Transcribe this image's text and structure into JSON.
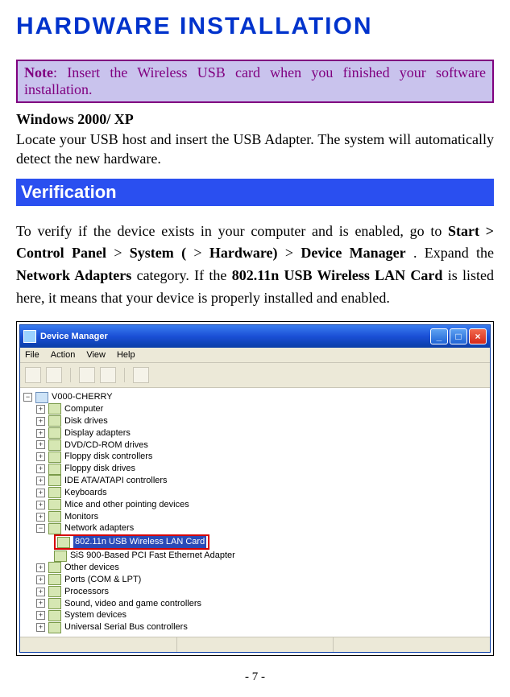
{
  "title": "HARDWARE INSTALLATION",
  "note_label": "Note",
  "note_text": ": Insert the Wireless USB card when you finished your software installation.",
  "win_heading": "Windows 2000/ XP",
  "win_text": "Locate your USB host and insert the USB Adapter. The system will automatically detect the new hardware.",
  "verification_header": "Verification",
  "verify_text_1": "To verify if the device exists in your computer and is enabled, go to ",
  "verify_start": "Start > Control Panel",
  "verify_gt1": " > ",
  "verify_system": "System (",
  "verify_gt2": "> ",
  "verify_hardware": "Hardware)",
  "verify_gt3": " > ",
  "verify_devmgr": "Device Manager",
  "verify_expand": ". Expand the ",
  "verify_netadapt": "Network Adapters",
  "verify_cat": " category. If the ",
  "verify_card": "802.11n USB Wireless LAN Card",
  "verify_tail": " is listed here, it means that your device is properly installed and enabled.",
  "dm": {
    "title": "Device Manager",
    "menu": {
      "file": "File",
      "action": "Action",
      "view": "View",
      "help": "Help"
    },
    "root": "V000-CHERRY",
    "nodes": [
      "Computer",
      "Disk drives",
      "Display adapters",
      "DVD/CD-ROM drives",
      "Floppy disk controllers",
      "Floppy disk drives",
      "IDE ATA/ATAPI controllers",
      "Keyboards",
      "Mice and other pointing devices",
      "Monitors",
      "Network adapters"
    ],
    "selected": "802.11n USB Wireless LAN Card",
    "sibling": "SiS 900-Based PCI Fast Ethernet Adapter",
    "nodes_after": [
      "Other devices",
      "Ports (COM & LPT)",
      "Processors",
      "Sound, video and game controllers",
      "System devices",
      "Universal Serial Bus controllers"
    ]
  },
  "page_number": "- 7 -"
}
